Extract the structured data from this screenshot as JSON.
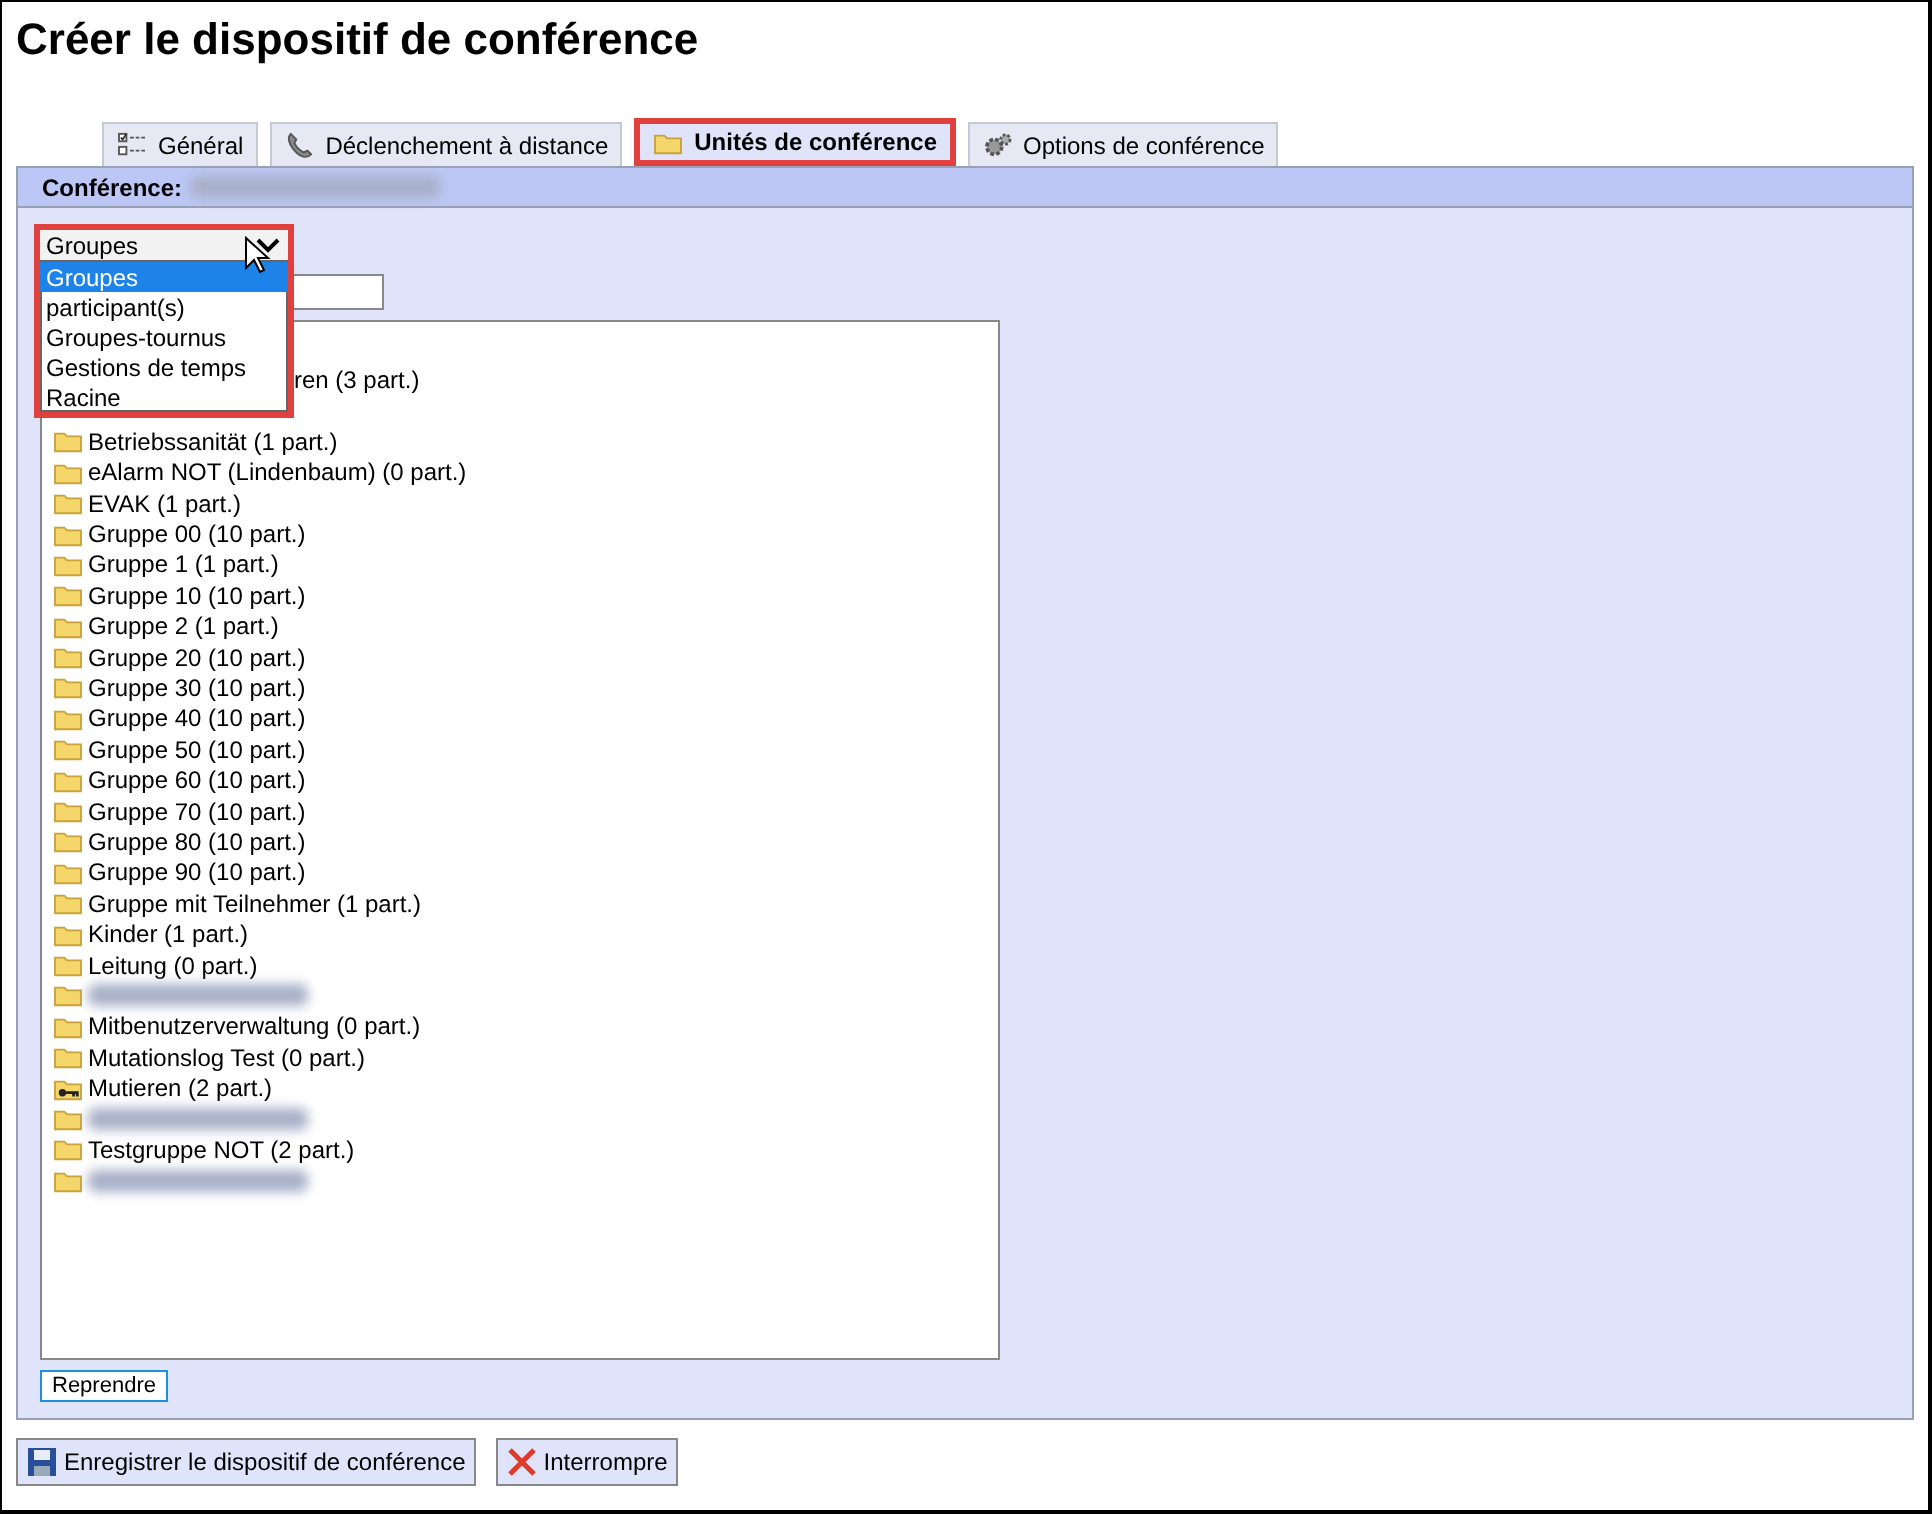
{
  "title": "Créer le dispositif de conférence",
  "tabs": [
    {
      "label": "Général",
      "kind": "checklist",
      "selected": false,
      "highlighted": false
    },
    {
      "label": "Déclenchement à distance",
      "kind": "phone",
      "selected": false,
      "highlighted": false
    },
    {
      "label": "Unités de conférence",
      "kind": "folder",
      "selected": true,
      "highlighted": true
    },
    {
      "label": "Options de conférence",
      "kind": "gears",
      "selected": false,
      "highlighted": false
    }
  ],
  "conference": {
    "label": "Conférence:",
    "value_redacted": true
  },
  "dropdown": {
    "value": "Groupes",
    "expanded": true,
    "highlighted": true,
    "options": [
      {
        "label": "Groupes",
        "selected": true
      },
      {
        "label": "participant(s)",
        "selected": false
      },
      {
        "label": "Groupes-tournus",
        "selected": false
      },
      {
        "label": "Gestions de temps",
        "selected": false
      },
      {
        "label": "Racine",
        "selected": false
      }
    ]
  },
  "tree": [
    {
      "kind": "covered"
    },
    {
      "kind": "partly-covered",
      "label": "ren (3 part.)"
    },
    {
      "kind": "covered"
    },
    {
      "kind": "folder",
      "label": "Betriebssanität (1 part.)"
    },
    {
      "kind": "folder",
      "label": "eAlarm NOT (Lindenbaum) (0 part.)"
    },
    {
      "kind": "folder",
      "label": "EVAK (1 part.)"
    },
    {
      "kind": "folder",
      "label": "Gruppe 00 (10 part.)"
    },
    {
      "kind": "folder",
      "label": "Gruppe 1 (1 part.)"
    },
    {
      "kind": "folder",
      "label": "Gruppe 10 (10 part.)"
    },
    {
      "kind": "folder",
      "label": "Gruppe 2 (1 part.)"
    },
    {
      "kind": "folder",
      "label": "Gruppe 20 (10 part.)"
    },
    {
      "kind": "folder",
      "label": "Gruppe 30 (10 part.)"
    },
    {
      "kind": "folder",
      "label": "Gruppe 40 (10 part.)"
    },
    {
      "kind": "folder",
      "label": "Gruppe 50 (10 part.)"
    },
    {
      "kind": "folder",
      "label": "Gruppe 60 (10 part.)"
    },
    {
      "kind": "folder",
      "label": "Gruppe 70 (10 part.)"
    },
    {
      "kind": "folder",
      "label": "Gruppe 80 (10 part.)"
    },
    {
      "kind": "folder",
      "label": "Gruppe 90 (10 part.)"
    },
    {
      "kind": "folder",
      "label": "Gruppe mit Teilnehmer (1 part.)"
    },
    {
      "kind": "folder",
      "label": "Kinder (1 part.)"
    },
    {
      "kind": "folder",
      "label": "Leitung (0 part.)"
    },
    {
      "kind": "redacted"
    },
    {
      "kind": "folder",
      "label": "Mitbenutzerverwaltung (0 part.)"
    },
    {
      "kind": "folder",
      "label": "Mutationslog Test (0 part.)"
    },
    {
      "kind": "key-folder",
      "label": "Mutieren (2 part.)"
    },
    {
      "kind": "redacted"
    },
    {
      "kind": "folder",
      "label": "Testgruppe NOT (2 part.)"
    },
    {
      "kind": "redacted"
    }
  ],
  "apply_button": "Reprendre",
  "buttons": [
    {
      "label": "Enregistrer le dispositif de conférence",
      "kind": "save"
    },
    {
      "label": "Interrompre",
      "kind": "cancel"
    }
  ]
}
